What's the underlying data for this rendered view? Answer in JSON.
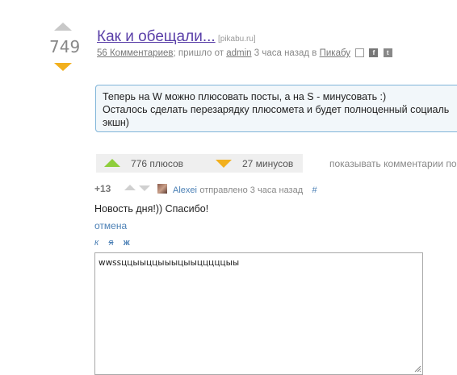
{
  "post": {
    "rating": "749",
    "title": "Как и обещали...",
    "domain": "[pikabu.ru]",
    "comments_link": "56 Комментариев",
    "meta_sep": ";",
    "meta_prefix": "пришло от",
    "author": "admin",
    "time_text": "3 часа назад в",
    "community": "Пикабу",
    "share_icons": [
      "save-icon",
      "facebook-icon",
      "twitter-icon"
    ],
    "description_lines": [
      "Теперь на W можно плюсовать посты, а на S - минусовать :)",
      "Осталось сделать перезарядку плюсомета и будет полноценный социаль",
      "экшн)"
    ]
  },
  "votes": {
    "plus_label": "776 плюсов",
    "minus_label": "27 минусов",
    "show_comments": "показывать комментарии по"
  },
  "comment": {
    "rating": "+13",
    "author": "Alexei",
    "meta": "отправлено 3 часа назад",
    "hash": "#",
    "text": "Новость дня!)) Спасибо!",
    "cancel": "отмена",
    "format_buttons": [
      "к",
      "я",
      "ж"
    ]
  },
  "reply": {
    "value": "wwssццыыццыыыцыыцццццыы"
  },
  "colors": {
    "title": "#5a3fa8",
    "vote_up": "#8ece3c",
    "vote_down": "#f2b01e",
    "box_border": "#7fb4d8",
    "link": "#4a7fb5"
  }
}
